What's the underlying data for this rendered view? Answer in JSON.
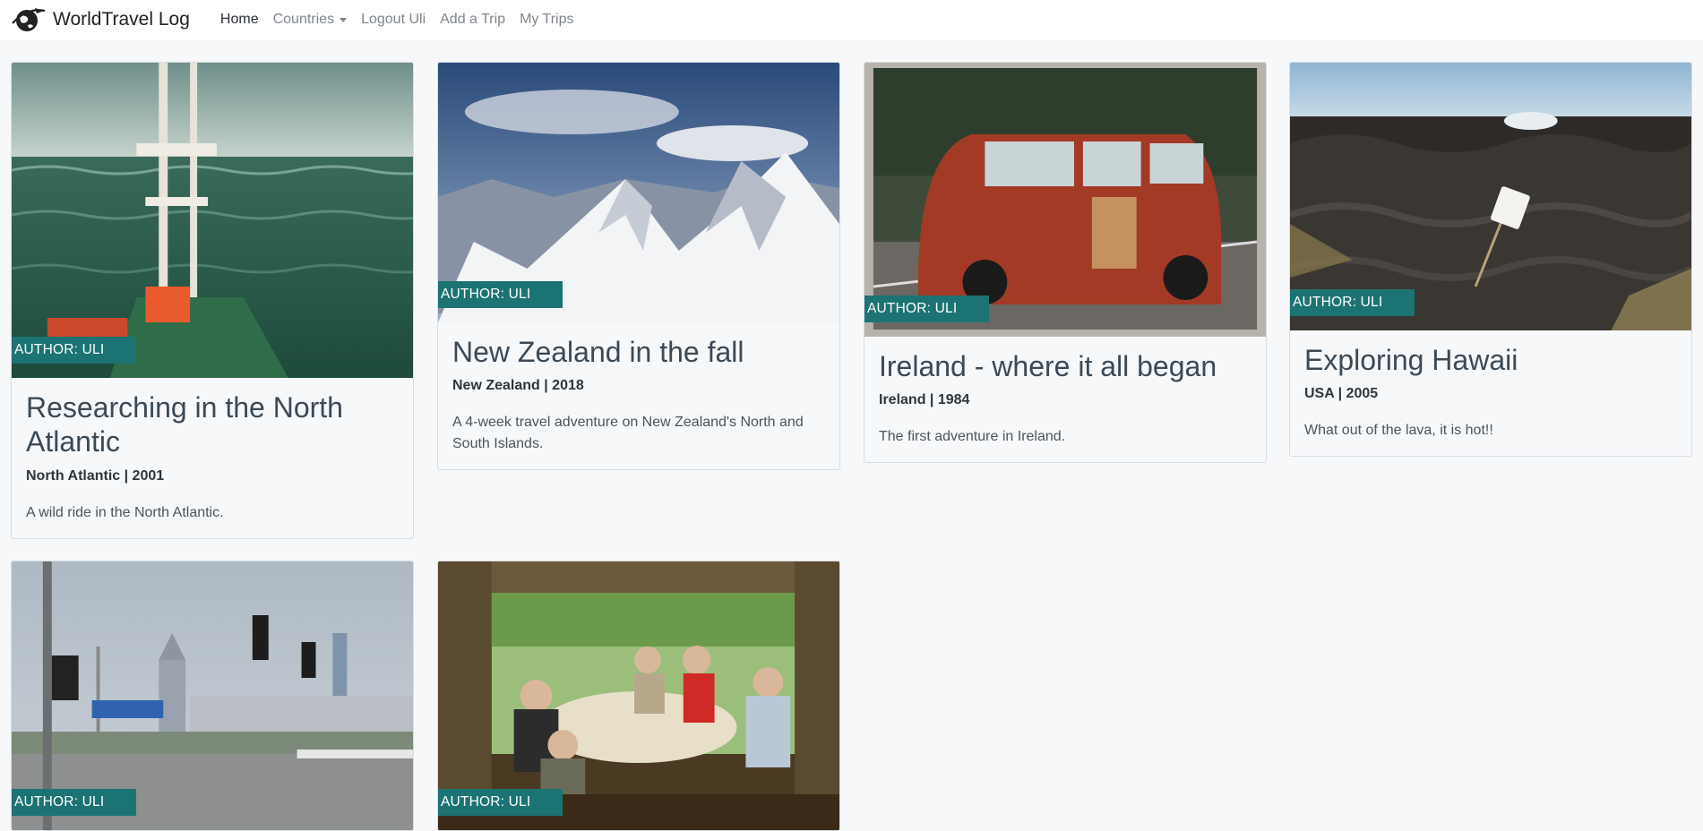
{
  "brand": {
    "name": "WorldTravel Log",
    "icon": "globe-plane-icon"
  },
  "nav": {
    "home": "Home",
    "countries": "Countries",
    "logout": "Logout Uli",
    "add_trip": "Add a Trip",
    "my_trips": "My Trips"
  },
  "colors": {
    "badge": "#1c7373",
    "background": "#f6f8fa"
  },
  "trips": [
    {
      "author": "AUTHOR: ULI",
      "title": "Researching in the North Atlantic",
      "meta": "North Atlantic | 2001",
      "description": "A wild ride in the North Atlantic."
    },
    {
      "author": "AUTHOR: ULI",
      "title": "New Zealand in the fall",
      "meta": "New Zealand | 2018",
      "description": "A 4-week travel adventure on New Zealand's North and South Islands."
    },
    {
      "author": "AUTHOR: ULI",
      "title": "Ireland - where it all began",
      "meta": "Ireland | 1984",
      "description": "The first adventure in Ireland."
    },
    {
      "author": "AUTHOR: ULI",
      "title": "Exploring Hawaii",
      "meta": "USA | 2005",
      "description": "What out of the lava, it is hot!!"
    },
    {
      "author": "AUTHOR: ULI"
    },
    {
      "author": "AUTHOR: ULI"
    }
  ]
}
